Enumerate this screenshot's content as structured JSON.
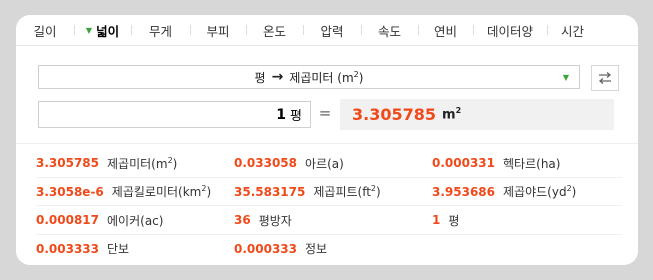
{
  "tabs": [
    {
      "label": "길이",
      "active": false
    },
    {
      "label": "넓이",
      "active": true
    },
    {
      "label": "무게",
      "active": false
    },
    {
      "label": "부피",
      "active": false
    },
    {
      "label": "온도",
      "active": false
    },
    {
      "label": "압력",
      "active": false
    },
    {
      "label": "속도",
      "active": false
    },
    {
      "label": "연비",
      "active": false
    },
    {
      "label": "데이터양",
      "active": false
    },
    {
      "label": "시간",
      "active": false
    }
  ],
  "converter": {
    "from_unit": "평",
    "to_unit": "제곱미터 (m",
    "to_unit_sup": "2",
    "to_unit_end": ")",
    "input_value": "1",
    "input_unit": "평",
    "equals": "=",
    "result_value": "3.305785",
    "result_unit": "m",
    "result_unit_sup": "2"
  },
  "results": [
    {
      "value": "3.305785",
      "unit": "제곱미터(m",
      "sup": "2",
      "end": ")"
    },
    {
      "value": "0.033058",
      "unit": "아르(a)",
      "sup": "",
      "end": ""
    },
    {
      "value": "0.000331",
      "unit": "헥타르(ha)",
      "sup": "",
      "end": ""
    },
    {
      "value": "3.3058e-6",
      "unit": "제곱킬로미터(km",
      "sup": "2",
      "end": ")"
    },
    {
      "value": "35.583175",
      "unit": "제곱피트(ft",
      "sup": "2",
      "end": ")"
    },
    {
      "value": "3.953686",
      "unit": "제곱야드(yd",
      "sup": "2",
      "end": ")"
    },
    {
      "value": "0.000817",
      "unit": "에이커(ac)",
      "sup": "",
      "end": ""
    },
    {
      "value": "36",
      "unit": "평방자",
      "sup": "",
      "end": ""
    },
    {
      "value": "1",
      "unit": "평",
      "sup": "",
      "end": ""
    },
    {
      "value": "0.003333",
      "unit": "단보",
      "sup": "",
      "end": ""
    },
    {
      "value": "0.000333",
      "unit": "정보",
      "sup": "",
      "end": ""
    }
  ],
  "colors": {
    "accent": "#f04a1a",
    "caret": "#3aa33a"
  },
  "icons": {
    "swap": "swap-arrows-icon",
    "dropdown": "dropdown-caret-icon"
  }
}
